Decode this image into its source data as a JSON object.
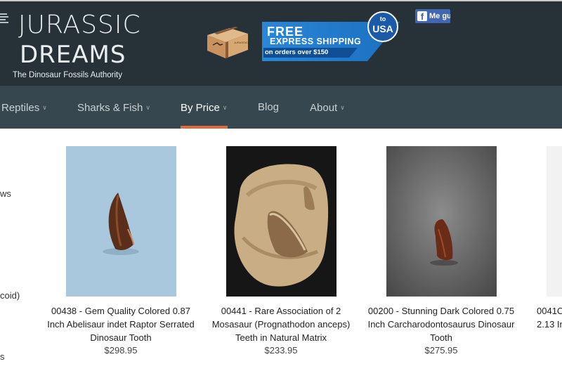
{
  "header": {
    "logo_line1": "JURASSIC",
    "logo_line2": "DREAMS",
    "tagline": "The Dinosaur Fossils Authority",
    "promo": {
      "free": "FREE",
      "express": "EXPRESS SHIPPING",
      "orders": "on orders over $150",
      "badge_to": "to",
      "badge_usa": "USA"
    },
    "facebook_label": "Me gu",
    "facebook_icon": "facebook-icon"
  },
  "nav": {
    "items": [
      {
        "label": "Reptiles",
        "has_dropdown": true
      },
      {
        "label": "Sharks & Fish",
        "has_dropdown": true
      },
      {
        "label": "By Price",
        "has_dropdown": true,
        "active": true
      },
      {
        "label": "Blog",
        "has_dropdown": false
      },
      {
        "label": "About",
        "has_dropdown": true
      }
    ],
    "active_color": "#e06a3b"
  },
  "sidebar": {
    "fragment_1": "ws",
    "fragment_2": "coid)",
    "fragment_3": "s"
  },
  "products": [
    {
      "title": "00438 - Gem Quality Colored 0.87 Inch Abelisaur indet Raptor Serrated Dinosaur Tooth",
      "price": "$298.95"
    },
    {
      "title": "00441 - Rare Association of 2 Mosasaur (Prognathodon anceps) Teeth in Natural Matrix",
      "price": "$233.95"
    },
    {
      "title": "00200 - Stunning Dark Colored 0.75 Inch Carcharodontosaurus Dinosaur Tooth",
      "price": "$275.95"
    },
    {
      "title": "0041C 2.13 In",
      "price": ""
    }
  ],
  "colors": {
    "header_bg": "#263238",
    "nav_bg": "#37474f",
    "accent": "#e06a3b",
    "promo_blue": "#1b6fc0"
  }
}
